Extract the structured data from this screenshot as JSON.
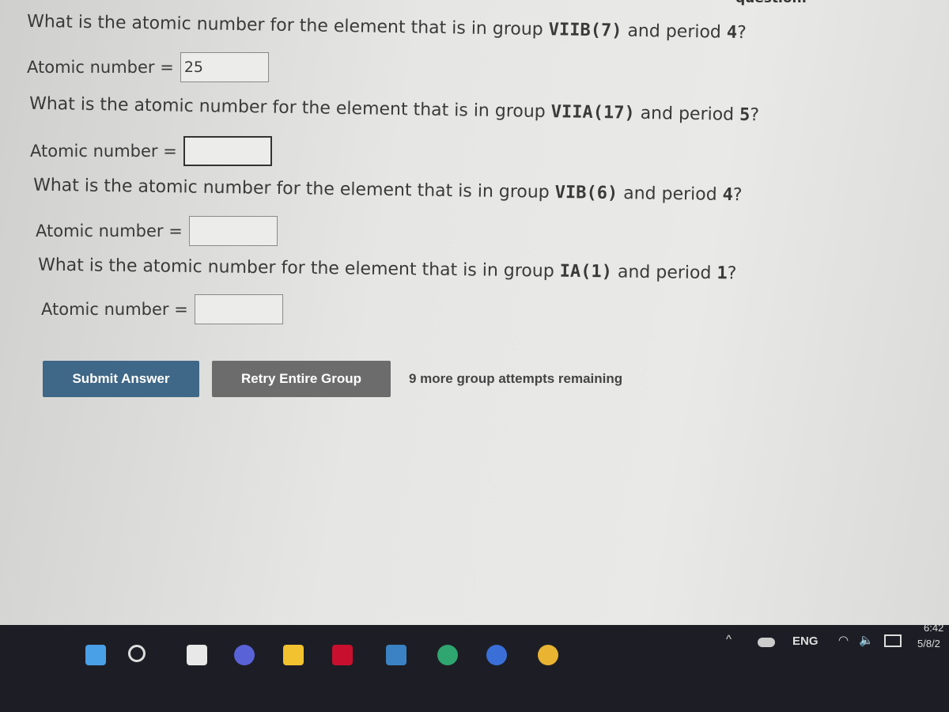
{
  "header_note": "question.",
  "questions": [
    {
      "prefix": "What is the atomic number for the element that is in group ",
      "group": "VIIB(7)",
      "mid": " and period ",
      "period": "4",
      "suffix": "?",
      "label": "Atomic number =",
      "value": "25"
    },
    {
      "prefix": "What is the atomic number for the element that is in group ",
      "group": "VIIA(17)",
      "mid": " and period ",
      "period": "5",
      "suffix": "?",
      "label": "Atomic number =",
      "value": ""
    },
    {
      "prefix": "What is the atomic number for the element that is in group ",
      "group": "VIB(6)",
      "mid": " and period ",
      "period": "4",
      "suffix": "?",
      "label": "Atomic number =",
      "value": ""
    },
    {
      "prefix": "What is the atomic number for the element that is in group ",
      "group": "IA(1)",
      "mid": " and period ",
      "period": "1",
      "suffix": "?",
      "label": "Atomic number =",
      "value": ""
    }
  ],
  "actions": {
    "submit": "Submit Answer",
    "retry": "Retry Entire Group",
    "attempts": "9 more group attempts remaining"
  },
  "taskbar": {
    "icons": [
      "windows-start-icon",
      "search-icon",
      "task-view-icon",
      "video-call-icon",
      "file-explorer-icon",
      "mcafee-icon",
      "store-icon",
      "edge-icon",
      "help-icon",
      "chrome-icon"
    ],
    "language": "ENG",
    "time": "6:42",
    "date": "5/8/2"
  },
  "colors": {
    "submit": "#3f6787",
    "retry": "#6c6c6c",
    "taskbar": "#1d1e25"
  }
}
